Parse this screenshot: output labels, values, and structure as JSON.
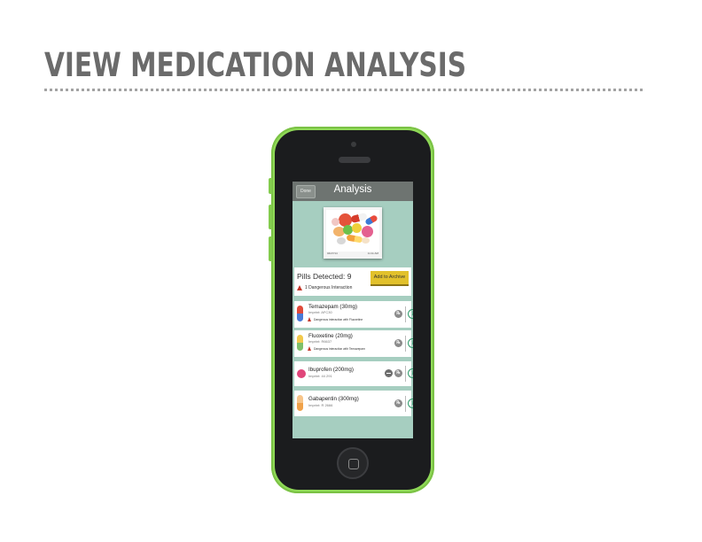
{
  "slide": {
    "title": "VIEW MEDICATION ANALYSIS"
  },
  "nav": {
    "done_label": "Done",
    "title": "Analysis"
  },
  "photo": {
    "date": "04/27/14",
    "time": "11:11 AM"
  },
  "detection": {
    "pills_detected": "Pills Detected: 9",
    "warning": "1 Dangerous Interaction",
    "archive_label": "Add to Archive"
  },
  "medications": [
    {
      "name": "Temazepam (30mg)",
      "imprint": "Imprint: AFC30",
      "warning": "Dangerous interaction with Fluoxetine",
      "icon": "capsule-red-blue"
    },
    {
      "name": "Fluoxetine (20mg)",
      "imprint": "Imprint: R6637",
      "warning": "Dangerous interaction with Temazepam",
      "icon": "capsule-yellow-green"
    },
    {
      "name": "Ibuprofen (200mg)",
      "imprint": "Imprint: 44 291",
      "warning": "",
      "icon": "tablet-pink"
    },
    {
      "name": "Gabapentin (300mg)",
      "imprint": "Imprint: R 2666",
      "warning": "",
      "icon": "capsule-orange"
    }
  ],
  "colors": {
    "screen_bg": "#a6cec0",
    "phone_body": "#8fd957",
    "archive_button": "#e2c12c",
    "warning": "#c4392b",
    "info": "#2e9a6a"
  }
}
